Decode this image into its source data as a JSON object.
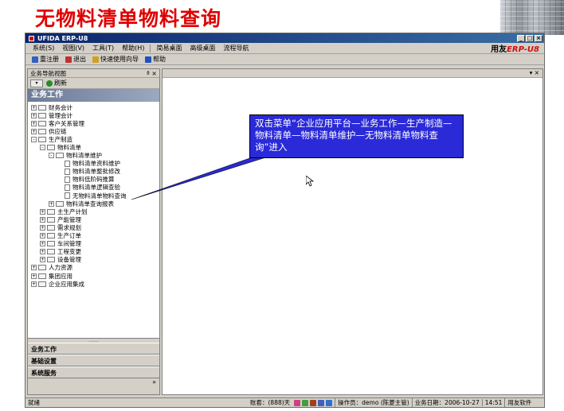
{
  "slide": {
    "title": "无物料清单物料查询"
  },
  "window": {
    "title": "UFIDA ERP-U8",
    "controls": [
      "_",
      "□",
      "×"
    ]
  },
  "menubar": {
    "items": [
      "系统(S)",
      "视图(V)",
      "工具(T)",
      "帮助(H)"
    ],
    "desk_items": [
      "简易桌面",
      "高级桌面",
      "流程导航"
    ],
    "brand_prefix": "用友",
    "brand_suffix": "ERP-U8"
  },
  "toolbar": {
    "items": [
      {
        "label": "重注册",
        "color": "#3060c0",
        "icon": "relogin-icon"
      },
      {
        "label": "退出",
        "color": "#c03030",
        "icon": "exit-icon"
      },
      {
        "label": "快速使用向导",
        "color": "#d0a020",
        "icon": "wizard-icon"
      },
      {
        "label": "帮助",
        "color": "#2050c0",
        "icon": "help-icon"
      }
    ]
  },
  "left_pane": {
    "header": "业务导航视图",
    "pin": "ª ×",
    "refresh_label": "刷新",
    "section_title": "业务工作",
    "tree": [
      {
        "label": "财务会计",
        "level": 0,
        "type": "folder",
        "exp": "+"
      },
      {
        "label": "管理会计",
        "level": 0,
        "type": "folder",
        "exp": "+"
      },
      {
        "label": "客户关系管理",
        "level": 0,
        "type": "folder",
        "exp": "+"
      },
      {
        "label": "供应链",
        "level": 0,
        "type": "folder",
        "exp": "+"
      },
      {
        "label": "生产制造",
        "level": 0,
        "type": "folder",
        "exp": "-"
      },
      {
        "label": "物料清单",
        "level": 1,
        "type": "folder",
        "exp": "-"
      },
      {
        "label": "物料清单维护",
        "level": 2,
        "type": "folder",
        "exp": "-"
      },
      {
        "label": "物料清单资料维护",
        "level": 3,
        "type": "doc"
      },
      {
        "label": "物料清单整批修改",
        "level": 3,
        "type": "doc"
      },
      {
        "label": "物料低阶码推算",
        "level": 3,
        "type": "doc"
      },
      {
        "label": "物料清单逻辑查验",
        "level": 3,
        "type": "doc"
      },
      {
        "label": "无物料清单物料查询",
        "level": 3,
        "type": "doc"
      },
      {
        "label": "物料清单查询报表",
        "level": 2,
        "type": "folder",
        "exp": "+"
      },
      {
        "label": "主生产计划",
        "level": 1,
        "type": "folder",
        "exp": "+"
      },
      {
        "label": "产能管理",
        "level": 1,
        "type": "folder",
        "exp": "+"
      },
      {
        "label": "需求规划",
        "level": 1,
        "type": "folder",
        "exp": "+"
      },
      {
        "label": "生产订单",
        "level": 1,
        "type": "folder",
        "exp": "+"
      },
      {
        "label": "车间管理",
        "level": 1,
        "type": "folder",
        "exp": "+"
      },
      {
        "label": "工程变更",
        "level": 1,
        "type": "folder",
        "exp": "+"
      },
      {
        "label": "设备管理",
        "level": 1,
        "type": "folder",
        "exp": "+"
      },
      {
        "label": "人力资源",
        "level": 0,
        "type": "folder",
        "exp": "+"
      },
      {
        "label": "集团应用",
        "level": 0,
        "type": "folder",
        "exp": "+"
      },
      {
        "label": "企业应用集成",
        "level": 0,
        "type": "folder",
        "exp": "+"
      }
    ],
    "grip": "......",
    "bottom_tabs": [
      "业务工作",
      "基础设置",
      "系统服务"
    ],
    "more": "»"
  },
  "right_pane": {
    "header_controls": "▾ ×"
  },
  "callout": {
    "text": "双击菜单“企业应用平台—业务工作—生产制造—物料清单—物料清单维护—无物料清单物料查询”进入",
    "color": "#2a2ad8"
  },
  "statusbar": {
    "ready": "就绪",
    "account": "账套：(888)天",
    "operator": "操作员：demo (陈菱主管)",
    "business_date": "业务日期：2006-10-27",
    "time": "14:51",
    "vendor": "用友软件"
  }
}
